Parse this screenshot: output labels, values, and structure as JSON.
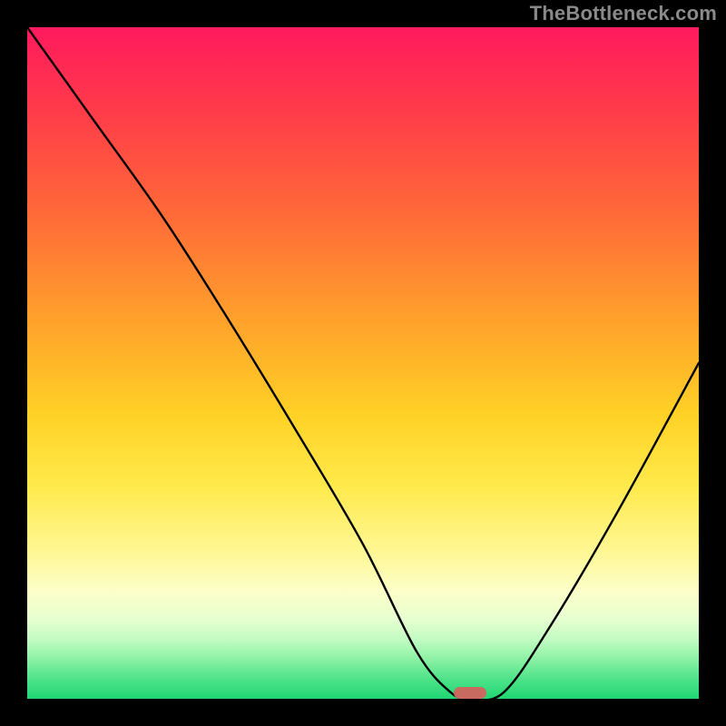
{
  "watermark": "TheBottleneck.com",
  "chart_data": {
    "type": "line",
    "title": "",
    "xlabel": "",
    "ylabel": "",
    "xlim": [
      0,
      100
    ],
    "ylim": [
      0,
      100
    ],
    "grid": false,
    "legend": false,
    "series": [
      {
        "name": "bottleneck-curve",
        "x": [
          0,
          10,
          20,
          29,
          40,
          50,
          58,
          63,
          66,
          71,
          78,
          88,
          100
        ],
        "y": [
          100,
          86,
          72,
          58,
          40,
          23,
          7,
          1,
          0,
          1,
          11,
          28,
          50
        ]
      }
    ],
    "marker": {
      "name": "optimal-point",
      "x": 66,
      "y": 0,
      "color": "#c96a60"
    },
    "background": "red-yellow-green vertical gradient (red=high bottleneck, green=balanced)"
  }
}
